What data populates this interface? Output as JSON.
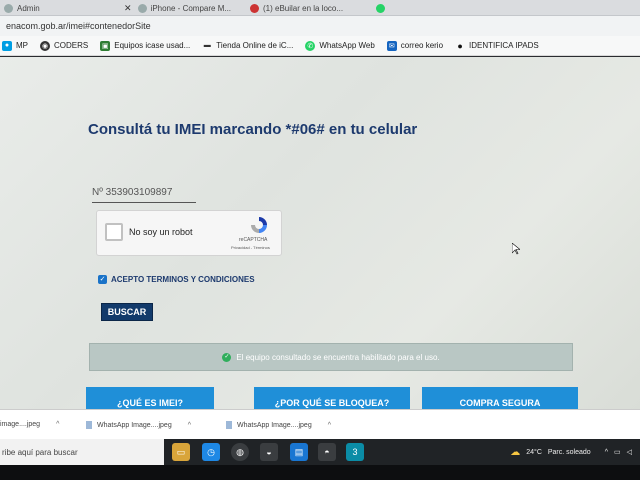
{
  "tabs": [
    {
      "title": "Admin"
    },
    {
      "title": "iPhone - Compare M..."
    },
    {
      "title": "(1) eBuilar en la loco..."
    },
    {
      "title": ""
    }
  ],
  "address_bar": {
    "url": "enacom.gob.ar/imei#contenedorSite"
  },
  "bookmarks": [
    {
      "label": "MP",
      "icon": "mercadopago-icon"
    },
    {
      "label": "CODERS",
      "icon": "coders-icon"
    },
    {
      "label": "Equipos icase usad...",
      "icon": "bookmark-green-icon"
    },
    {
      "label": "Tienda Online de iC...",
      "icon": "bookmark-dash-icon"
    },
    {
      "label": "WhatsApp Web",
      "icon": "whatsapp-icon"
    },
    {
      "label": "correo kerio",
      "icon": "mail-icon"
    },
    {
      "label": "IDENTIFICA IPADS",
      "icon": "apple-icon"
    }
  ],
  "page": {
    "title": "Consultá tu IMEI marcando *#06# en tu celular",
    "imei_value": "Nº 353903109897",
    "recaptcha": {
      "label": "No soy un robot",
      "brand": "reCAPTCHA",
      "links": "Privacidad - Términos"
    },
    "terms_label": "ACEPTO TERMINOS Y CONDICIONES",
    "terms_checked": true,
    "search_button": "BUSCAR",
    "result_message": "El equipo consultado se encuentra habilitado para el uso.",
    "nav_buttons": [
      {
        "label": "¿QUÉ ES IMEI?"
      },
      {
        "label": "¿POR QUÉ SE BLOQUEA?"
      },
      {
        "label": "COMPRA SEGURA"
      }
    ]
  },
  "downloads": [
    {
      "name": "image....jpeg"
    },
    {
      "name": "WhatsApp Image....jpeg"
    },
    {
      "name": "WhatsApp Image....jpeg"
    }
  ],
  "taskbar": {
    "search_placeholder": "ribe aquí para buscar",
    "temperature": "24°C",
    "weather": "Parc. soleado"
  },
  "colors": {
    "title": "#1d3a6e",
    "button": "#123a6b",
    "nav_button": "#1f8fd8",
    "success": "#2fae5c"
  }
}
